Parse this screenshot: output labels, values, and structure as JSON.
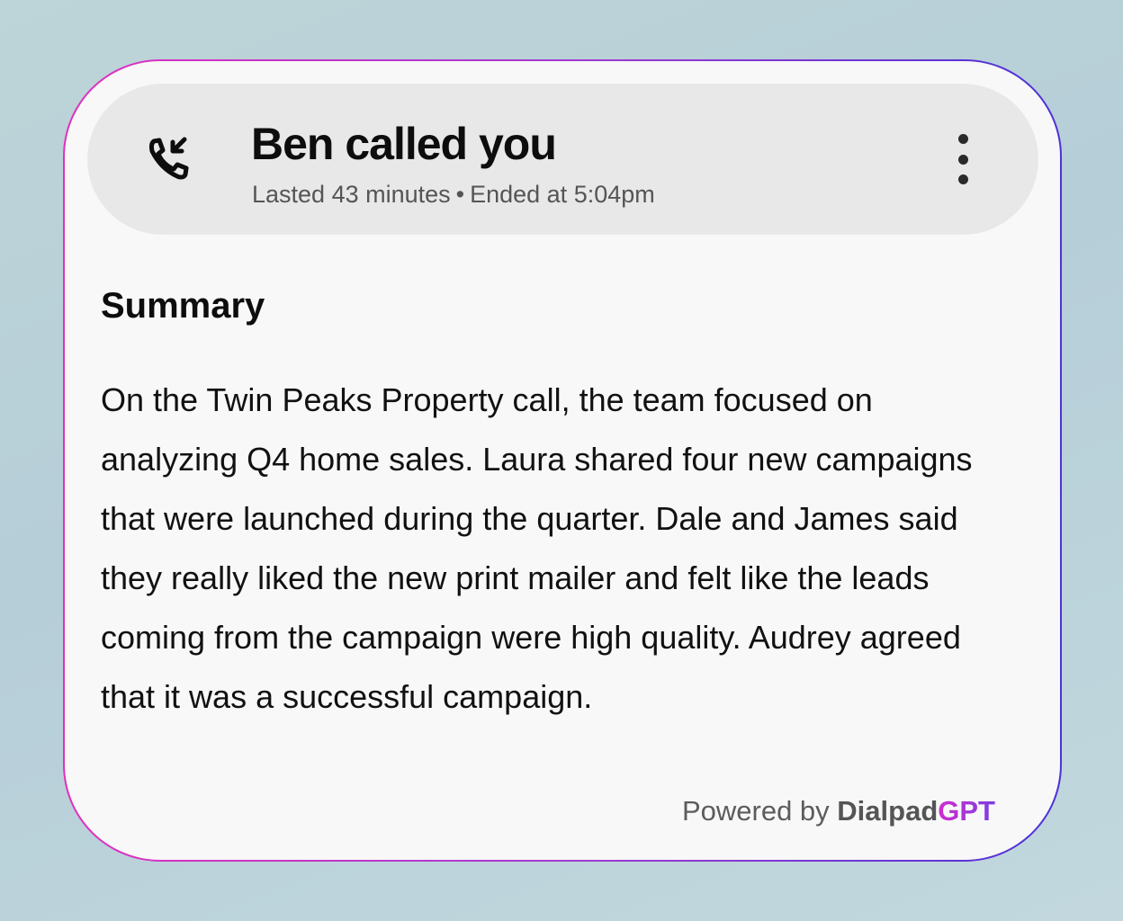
{
  "call_card": {
    "header": {
      "icon": "incoming-call-icon",
      "title": "Ben called you",
      "duration": "Lasted 43 minutes",
      "separator": "•",
      "ended": "Ended at 5:04pm",
      "menu_icon": "more-vertical-icon"
    },
    "summary": {
      "heading": "Summary",
      "body": "On the Twin Peaks Property call, the team focused on analyzing Q4 home sales. Laura shared four new campaigns that were launched during the quarter. Dale and James said they really liked the new print mailer and felt like the leads coming from the campaign were high quality. Audrey agreed that it was a successful campaign."
    },
    "footer": {
      "powered_by": "Powered by",
      "brand": "Dialpad",
      "brand_suffix": "GPT"
    }
  },
  "colors": {
    "border_gradient_start": "#e030c0",
    "border_gradient_end": "#4b33d6",
    "gpt_gradient_start": "#d12ccf",
    "gpt_gradient_end": "#7a3ee0",
    "card_background": "#f8f8f8",
    "header_background": "#e8e8e8",
    "page_background": "#bdd4d8"
  }
}
